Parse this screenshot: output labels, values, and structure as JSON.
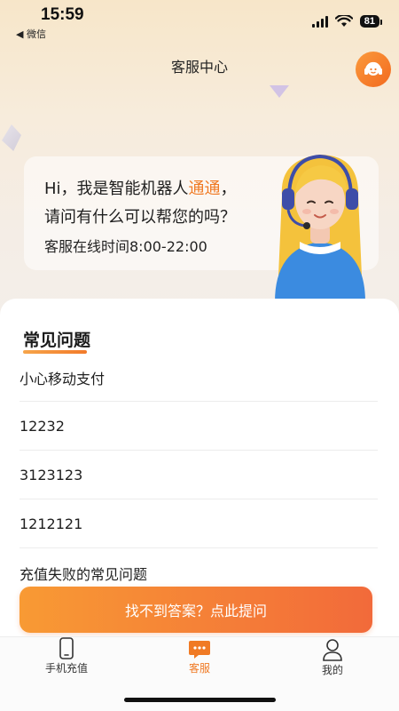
{
  "status_bar": {
    "time": "15:59",
    "back_label": "◀ 微信",
    "battery": "81"
  },
  "nav": {
    "title": "客服中心",
    "cs_icon": "headset-icon"
  },
  "welcome": {
    "greeting_prefix": "Hi，我是智能机器人",
    "bot_name": "通通",
    "greeting_suffix": "，",
    "question": "请问有什么可以帮您的吗？",
    "hours": "客服在线时间8:00-22:00"
  },
  "faq": {
    "title": "常见问题",
    "items": [
      "小心移动支付",
      "12232",
      "3123123",
      "1212121",
      "充值失败的常见问题"
    ]
  },
  "ask_button": "找不到答案？点此提问",
  "tabs": [
    {
      "label": "手机充值",
      "icon": "phone-icon",
      "active": false
    },
    {
      "label": "客服",
      "icon": "chat-icon",
      "active": true
    },
    {
      "label": "我的",
      "icon": "user-icon",
      "active": false
    }
  ],
  "colors": {
    "accent": "#f07a24",
    "button_start": "#f89a34",
    "button_end": "#f26a3a"
  }
}
